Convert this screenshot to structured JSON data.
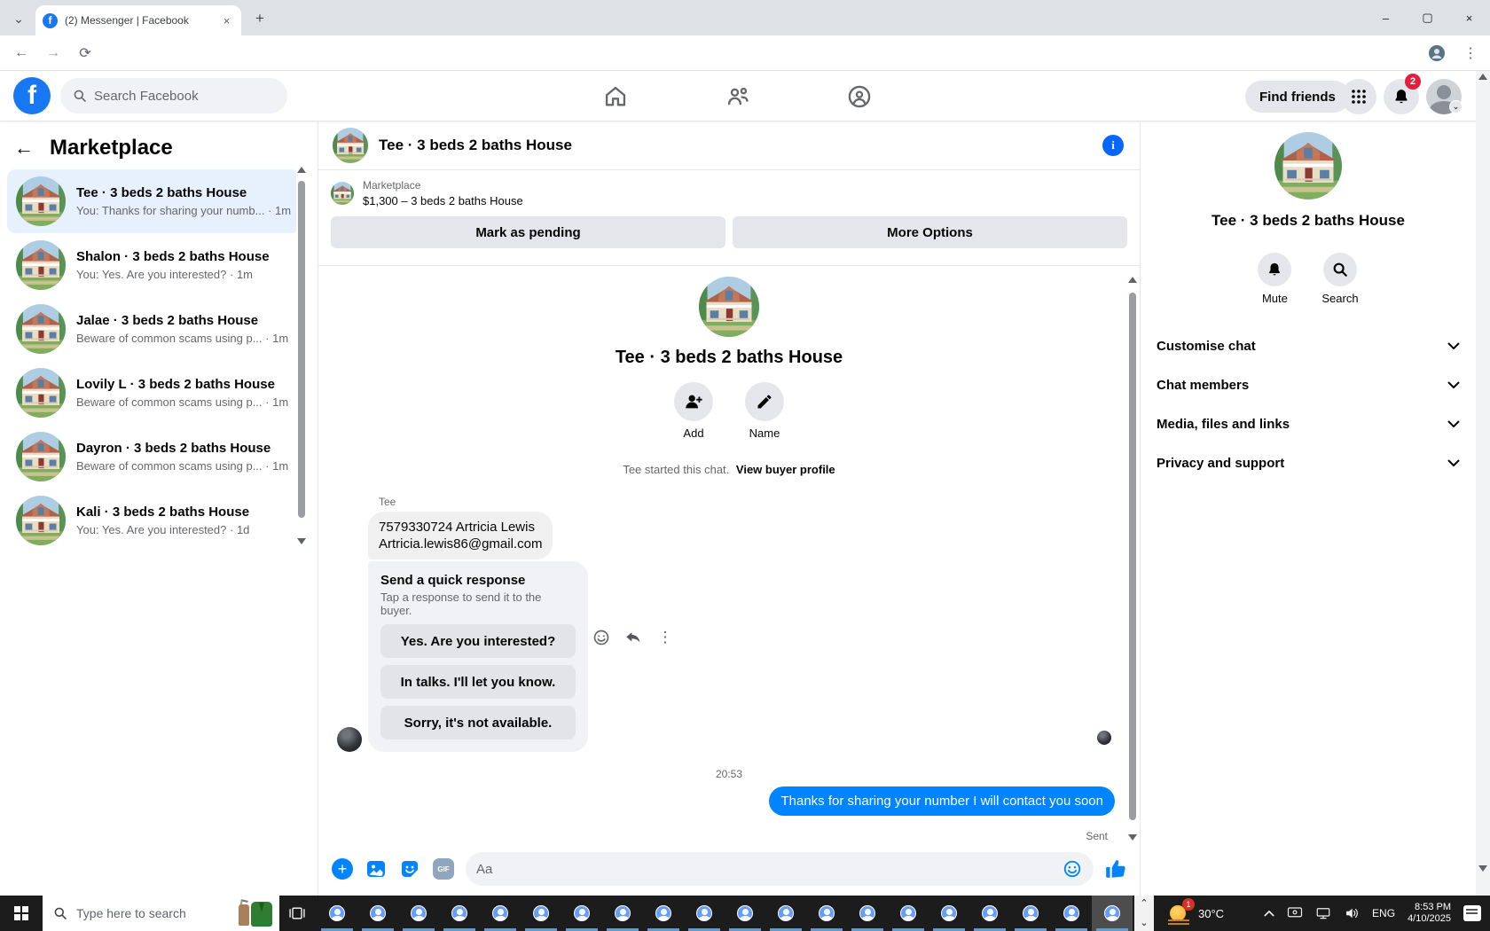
{
  "browser": {
    "tab_title": "(2) Messenger | Facebook",
    "url": "facebook.com/messages/t/9907865085914633"
  },
  "glyphs": {
    "tab_chevron": "⌄",
    "tab_close": "×",
    "new_tab": "+",
    "win_min": "–",
    "win_max": "▢",
    "win_close": "×",
    "back": "←",
    "forward": "→",
    "reload": "⟳",
    "sidebar_back": "←",
    "info": "i",
    "gif": "GIF",
    "kebab": "⋮",
    "plus": "+",
    "hidden_icons": "︿",
    "overflow_up": "⌃",
    "overflow_down": "⌄",
    "profile_chevron": "⌄",
    "f_logo": "f"
  },
  "fb_header": {
    "search_placeholder": "Search Facebook",
    "find_friends": "Find friends",
    "notifications_badge": "2"
  },
  "sidebar": {
    "title": "Marketplace",
    "conversations": [
      {
        "title": "Tee · 3 beds 2 baths House",
        "snippet": "You: Thanks for sharing your numb...",
        "time": "1m",
        "selected": true
      },
      {
        "title": "Shalon · 3 beds 2 baths House",
        "snippet": "You: Yes. Are you interested?",
        "time": "1m"
      },
      {
        "title": "Jalae · 3 beds 2 baths House",
        "snippet": "Beware of common scams using p...",
        "time": "1m"
      },
      {
        "title": "Lovily L · 3 beds 2 baths House",
        "snippet": "Beware of common scams using p...",
        "time": "1m"
      },
      {
        "title": "Dayron · 3 beds 2 baths House",
        "snippet": "Beware of common scams using p...",
        "time": "1m"
      },
      {
        "title": "Kali · 3 beds 2 baths House",
        "snippet": "You: Yes. Are you interested?",
        "time": "1d"
      }
    ]
  },
  "chat": {
    "title": "Tee · 3 beds 2 baths House",
    "marketplace_label": "Marketplace",
    "listing_price": "$1,300 – 3 beds 2 baths House",
    "mark_pending": "Mark as pending",
    "more_options": "More Options",
    "profile_name": "Tee · 3 beds 2 baths House",
    "add_label": "Add",
    "name_label": "Name",
    "started_text": "Tee started this chat.",
    "view_buyer_profile": "View buyer profile",
    "sender": "Tee",
    "contact_lines": [
      "7579330724 Artricia Lewis",
      "Artricia.lewis86@gmail.com"
    ],
    "quick": {
      "title": "Send a quick response",
      "subtitle": "Tap a response to send it to the buyer.",
      "replies": [
        {
          "label": "Yes. Are you interested?"
        },
        {
          "label": "In talks. I'll let you know."
        },
        {
          "label": "Sorry, it's not available."
        }
      ]
    },
    "timestamp": "20:53",
    "outgoing_message": "Thanks for sharing your number I will contact you soon",
    "status": "Sent",
    "composer_placeholder": "Aa"
  },
  "right_panel": {
    "title": "Tee · 3 beds 2 baths House",
    "mute": "Mute",
    "search": "Search",
    "sections": [
      {
        "label": "Customise chat"
      },
      {
        "label": "Chat members"
      },
      {
        "label": "Media, files and links"
      },
      {
        "label": "Privacy and support"
      }
    ]
  },
  "taskbar": {
    "search_placeholder": "Type here to search",
    "chrome_windows": 20,
    "weather_badge": "1",
    "temperature": "30°C",
    "language": "ENG",
    "time": "8:53 PM",
    "date": "4/10/2025"
  },
  "colors": {
    "facebook_blue": "#1877f2",
    "messenger_outgoing": "#0084ff",
    "badge_red": "#e41e3f",
    "selected_conversation": "#e7f0fd"
  }
}
